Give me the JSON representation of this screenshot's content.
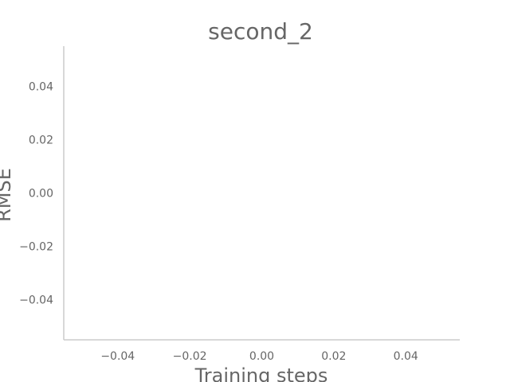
{
  "chart_data": {
    "type": "line",
    "title": "second_2",
    "xlabel": "Training steps",
    "ylabel": "RMSE",
    "xlim": [
      -0.055,
      0.055
    ],
    "ylim": [
      -0.055,
      0.055
    ],
    "xticks": [
      -0.04,
      -0.02,
      0.0,
      0.02,
      0.04
    ],
    "yticks": [
      -0.04,
      -0.02,
      0.0,
      0.02,
      0.04
    ],
    "xtick_labels": [
      "−0.04",
      "−0.02",
      "0.00",
      "0.02",
      "0.04"
    ],
    "ytick_labels": [
      "−0.04",
      "−0.02",
      "0.00",
      "0.02",
      "0.04"
    ],
    "series": [],
    "grid": false,
    "spines": [
      "left",
      "bottom"
    ],
    "colors": {
      "text": "#666666",
      "spine": "#cccccc",
      "background": "#ffffff"
    }
  }
}
